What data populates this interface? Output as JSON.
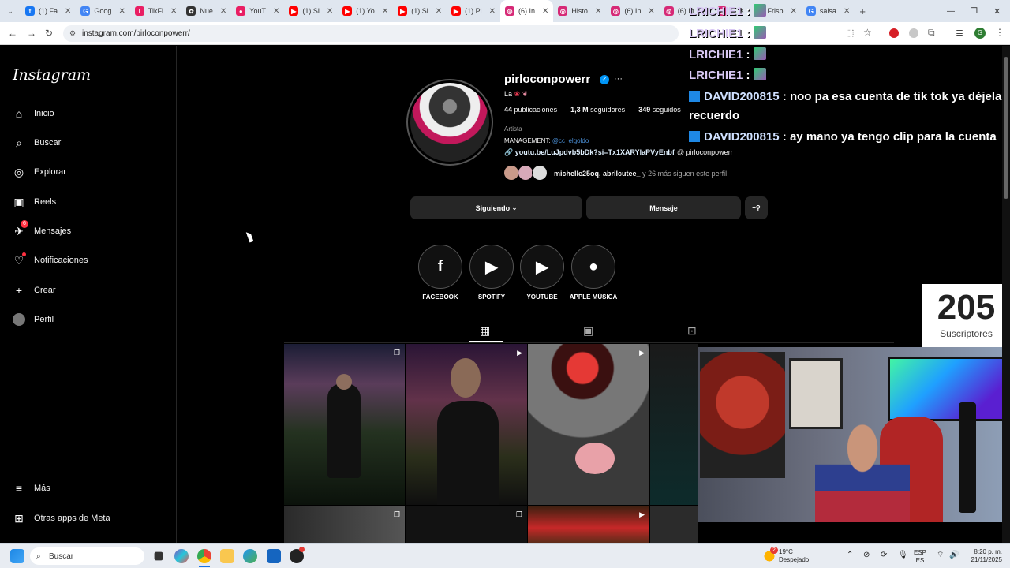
{
  "browser": {
    "tabs": [
      {
        "label": "(1) Fa",
        "color": "#1877f2",
        "glyph": "f",
        "icon": "facebook-icon"
      },
      {
        "label": "Goog",
        "color": "#4285f4",
        "glyph": "G",
        "icon": "google-icon"
      },
      {
        "label": "TikFi",
        "color": "#e91e63",
        "glyph": "T",
        "icon": "tikfinity-icon"
      },
      {
        "label": "Nue",
        "color": "#333333",
        "glyph": "✿",
        "icon": "openai-icon"
      },
      {
        "label": "YouT",
        "color": "#e91e63",
        "glyph": "●",
        "icon": "youtube-icon"
      },
      {
        "label": "(1) Si",
        "color": "#ff0000",
        "glyph": "▶",
        "icon": "youtube-icon"
      },
      {
        "label": "(1) Yo",
        "color": "#ff0000",
        "glyph": "▶",
        "icon": "youtube-icon"
      },
      {
        "label": "(1) Si",
        "color": "#ff0000",
        "glyph": "▶",
        "icon": "youtube-icon"
      },
      {
        "label": "(1) Pi",
        "color": "#ff0000",
        "glyph": "▶",
        "icon": "youtube-icon"
      },
      {
        "label": "(6) In",
        "color": "#d62976",
        "glyph": "◎",
        "icon": "instagram-icon",
        "active": true
      },
      {
        "label": "Histo",
        "color": "#d62976",
        "glyph": "◎",
        "icon": "instagram-icon"
      },
      {
        "label": "(6) In",
        "color": "#d62976",
        "glyph": "◎",
        "icon": "instagram-icon"
      },
      {
        "label": "(6) In",
        "color": "#d62976",
        "glyph": "◎",
        "icon": "instagram-icon"
      },
      {
        "label": "",
        "color": "#d62976",
        "glyph": "◎",
        "icon": "instagram-icon"
      },
      {
        "label": "Frisb",
        "color": "#f2b233",
        "glyph": "☺",
        "icon": "frisbee-icon"
      },
      {
        "label": "salsa",
        "color": "#4285f4",
        "glyph": "G",
        "icon": "google-icon"
      }
    ],
    "url": "instagram.com/pirloconpowerr/"
  },
  "sidebar": {
    "logo": "Instagram",
    "items": [
      {
        "label": "Inicio",
        "icon": "home-icon",
        "glyph": "⌂"
      },
      {
        "label": "Buscar",
        "icon": "search-icon",
        "glyph": "⌕"
      },
      {
        "label": "Explorar",
        "icon": "compass-icon",
        "glyph": "◎"
      },
      {
        "label": "Reels",
        "icon": "reels-icon",
        "glyph": "▣"
      },
      {
        "label": "Mensajes",
        "icon": "messenger-icon",
        "glyph": "✈",
        "badge": "6"
      },
      {
        "label": "Notificaciones",
        "icon": "heart-icon",
        "glyph": "♡"
      },
      {
        "label": "Crear",
        "icon": "plus-icon",
        "glyph": "+"
      },
      {
        "label": "Perfil",
        "icon": "avatar-icon",
        "glyph": "●"
      }
    ],
    "bottom": [
      {
        "label": "Más",
        "icon": "menu-icon",
        "glyph": "≡"
      },
      {
        "label": "Otras apps de Meta",
        "icon": "meta-apps-icon",
        "glyph": "⊞"
      }
    ]
  },
  "profile": {
    "username": "pirloconpowerr",
    "name": "La",
    "posts_count": "44",
    "posts_label": "publicaciones",
    "followers_count": "1,3 M",
    "followers_label": "seguidores",
    "following_count": "349",
    "following_label": "seguidos",
    "category": "Artista",
    "management_label": "MANAGEMENT:",
    "management_handle": "@cc_elgoldo",
    "link": "youtu.be/LuJpdvb5bDk?si=Tx1XARYlaPVyEnbf",
    "threads": "pirloconpowerr",
    "followed_by_names": "michelle25oq, abrilcutee_",
    "followed_by_rest": "y 26 más siguen este perfil",
    "following_button": "Siguiendo",
    "message_button": "Mensaje",
    "highlights": [
      {
        "label": "FACEBOOK",
        "glyph": "f",
        "icon": "facebook-icon"
      },
      {
        "label": "SPOTIFY",
        "glyph": "▶",
        "icon": "youtube-icon"
      },
      {
        "label": "YOUTUBE",
        "glyph": "▶",
        "icon": "youtube-icon"
      },
      {
        "label": "APPLE MÚSICA",
        "glyph": "",
        "icon": "apple-icon"
      }
    ]
  },
  "chat": [
    {
      "user": "LRICHIE1",
      "message": "",
      "emote": "party-emote"
    },
    {
      "user": "LRICHIE1",
      "message": "",
      "emote": "hacker-emote"
    },
    {
      "user": "LRICHIE1",
      "message": "",
      "emote": "dj-emote"
    },
    {
      "user": "LRICHIE1",
      "message": "",
      "emote": "equalizer-emote"
    },
    {
      "user": "DAVID200815",
      "message": "noo pa esa cuenta de tik tok ya déjela c",
      "continuation": "recuerdo"
    },
    {
      "user": "DAVID200815",
      "message": "ay mano ya tengo clip para la cuenta"
    }
  ],
  "subs": {
    "count": "205",
    "label": "Suscriptores"
  },
  "taskbar": {
    "search": "Buscar",
    "weather_temp": "19°C",
    "weather_desc": "Despejado",
    "weather_badge": "2",
    "lang1": "ESP",
    "lang2": "ES",
    "time": "8:20 p. m.",
    "date": "21/11/2025"
  }
}
